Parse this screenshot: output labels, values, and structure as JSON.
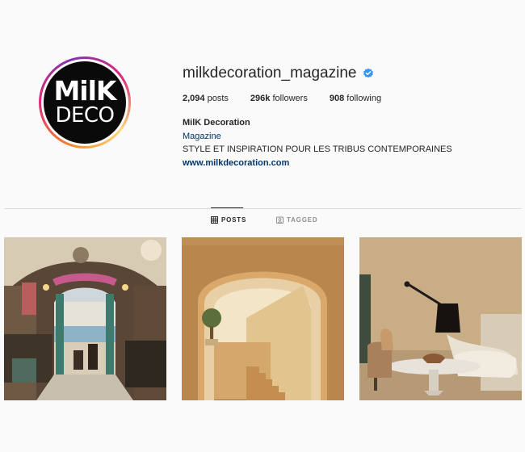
{
  "profile": {
    "avatar_logo_top": "MilK",
    "avatar_logo_bottom": "DECO",
    "username": "milkdecoration_magazine",
    "verified": true,
    "stats": {
      "posts_count": "2,094",
      "posts_label": "posts",
      "followers_count": "296k",
      "followers_label": "followers",
      "following_count": "908",
      "following_label": "following"
    },
    "bio": {
      "name": "MilK Decoration",
      "category": "Magazine",
      "description": "STYLE ET INSPIRATION POUR LES TRIBUS CONTEMPORAINES",
      "link": "www.milkdecoration.com"
    }
  },
  "tabs": [
    {
      "label": "POSTS",
      "icon": "grid-icon",
      "active": true
    },
    {
      "label": "TAGGED",
      "icon": "tagged-icon",
      "active": false
    }
  ],
  "posts": [
    {
      "icon": "photo-seaside-cafe"
    },
    {
      "icon": "photo-arched-staircase"
    },
    {
      "icon": "photo-living-room-lamp"
    }
  ],
  "colors": {
    "background": "#fafafa",
    "text": "#262626",
    "secondary_text": "#8e8e8e",
    "link": "#00376b",
    "verified_blue": "#3897f0",
    "divider": "#dbdbdb"
  }
}
